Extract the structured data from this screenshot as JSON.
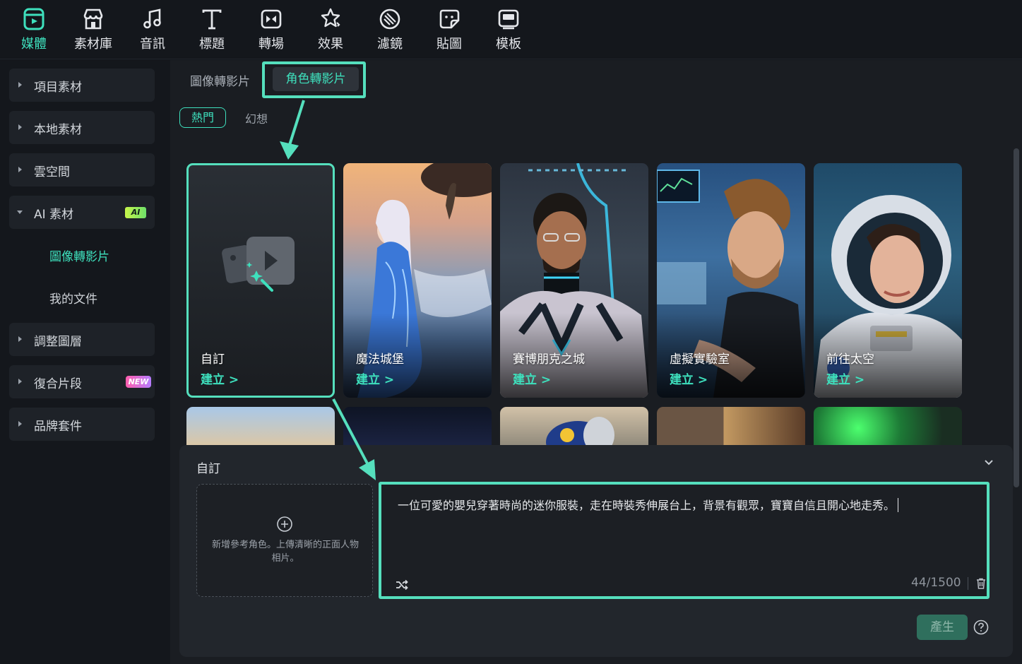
{
  "toolbar": {
    "items": [
      {
        "label": "媒體",
        "icon": "media-icon"
      },
      {
        "label": "素材庫",
        "icon": "store-icon"
      },
      {
        "label": "音訊",
        "icon": "music-note-icon"
      },
      {
        "label": "標題",
        "icon": "text-t-icon"
      },
      {
        "label": "轉場",
        "icon": "transition-icon"
      },
      {
        "label": "效果",
        "icon": "effects-star-icon"
      },
      {
        "label": "濾鏡",
        "icon": "filter-icon"
      },
      {
        "label": "貼圖",
        "icon": "sticker-icon"
      },
      {
        "label": "模板",
        "icon": "template-icon"
      }
    ],
    "active_index": 0
  },
  "sidebar": {
    "items": [
      {
        "label": "項目素材"
      },
      {
        "label": "本地素材"
      },
      {
        "label": "雲空間"
      },
      {
        "label": "AI 素材",
        "badge": "AI",
        "expanded": true
      },
      {
        "label": "調整圖層"
      },
      {
        "label": "復合片段",
        "badge": "NEW"
      },
      {
        "label": "品牌套件"
      }
    ],
    "subitems": [
      {
        "label": "圖像轉影片",
        "active": true
      },
      {
        "label": "我的文件",
        "active": false
      }
    ]
  },
  "main": {
    "tabs": [
      {
        "label": "圖像轉影片"
      },
      {
        "label": "角色轉影片"
      }
    ],
    "active_tab": 1,
    "filters": [
      {
        "label": "熱門"
      },
      {
        "label": "幻想"
      }
    ],
    "active_filter": 0,
    "cards": [
      {
        "title": "自訂",
        "action": "建立 >",
        "custom": true
      },
      {
        "title": "魔法城堡",
        "action": "建立 >"
      },
      {
        "title": "賽博朋克之城",
        "action": "建立 >"
      },
      {
        "title": "虛擬實驗室",
        "action": "建立 >"
      },
      {
        "title": "前往太空",
        "action": "建立 >"
      }
    ]
  },
  "panel": {
    "title": "自訂",
    "upload_hint": "新增參考角色。上傳清晰的正面人物相片。",
    "prompt": "一位可愛的嬰兒穿著時尚的迷你服裝，走在時裝秀伸展台上，背景有觀眾，寶寶自信且開心地走秀。",
    "char_count": "44/1500",
    "generate_label": "產生"
  },
  "colors": {
    "accent": "#3ee0bd",
    "highlight": "#55dfbd",
    "background": "#1a1d22",
    "sidebar_bg": "#14171c"
  }
}
